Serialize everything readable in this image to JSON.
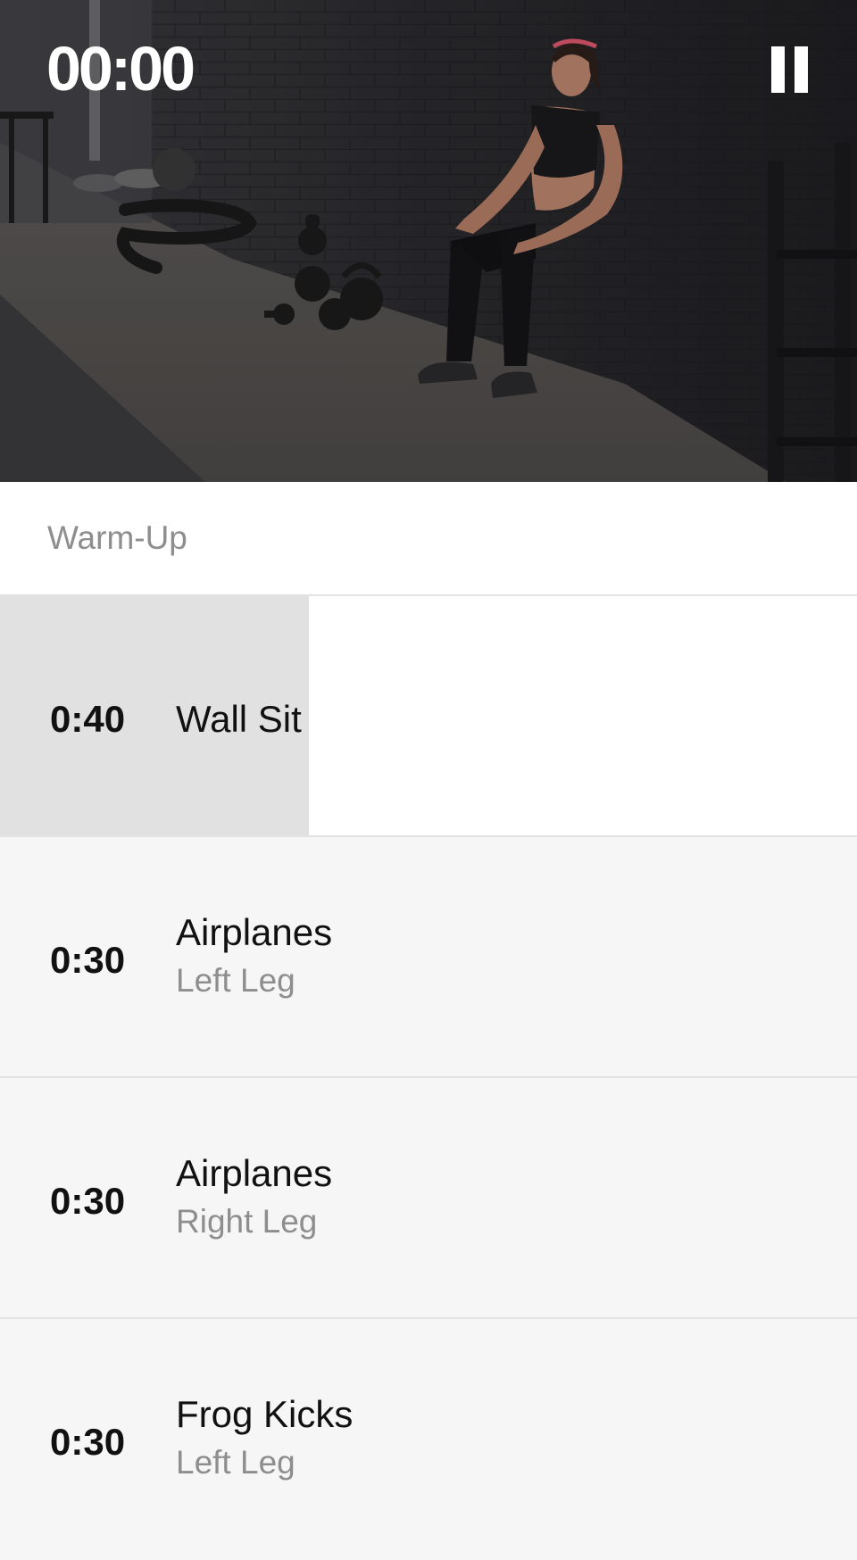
{
  "player": {
    "timer": "00:00",
    "state": "playing"
  },
  "section": {
    "title": "Warm-Up"
  },
  "exercises": [
    {
      "duration": "0:40",
      "name": "Wall Sit",
      "side": "",
      "progress": 0.36
    },
    {
      "duration": "0:30",
      "name": "Airplanes",
      "side": "Left Leg"
    },
    {
      "duration": "0:30",
      "name": "Airplanes",
      "side": "Right Leg"
    },
    {
      "duration": "0:30",
      "name": "Frog Kicks",
      "side": "Left Leg"
    }
  ],
  "icons": {
    "control": "pause-icon"
  },
  "colors": {
    "progress_fill": "#e1e1e1",
    "current_row": "#ffffff",
    "row_bg": "#f6f6f6",
    "secondary_text": "#8e8e8e"
  }
}
